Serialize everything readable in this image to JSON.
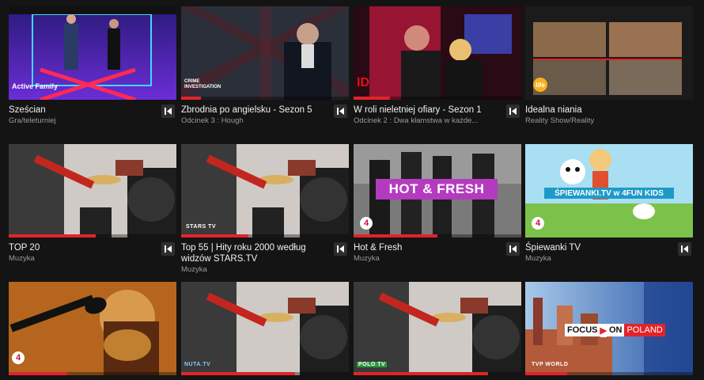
{
  "rows": [
    [
      {
        "title": "Sześcian",
        "subtitle": "Gra/teleturniej",
        "progress": 0,
        "badge": "Active Family"
      },
      {
        "title": "Zbrodnia po angielsku - Sezon 5",
        "subtitle": "Odcinek 3 : Hough",
        "progress": 0.12,
        "badge": "CRIME INVESTIGATION"
      },
      {
        "title": "W roli nieletniej ofiary - Sezon 1",
        "subtitle": "Odcinek 2 : Dwa kłamstwa w każde...",
        "progress": 0.22,
        "badge": "ID"
      },
      {
        "title": "Idealna niania",
        "subtitle": "Reality Show/Reality",
        "progress": 0,
        "badge": "life"
      }
    ],
    [
      {
        "title": "TOP 20",
        "subtitle": "Muzyka",
        "progress": 0.52,
        "badge": ""
      },
      {
        "title": "Top 55 | Hity roku 2000 według widzów STARS.TV",
        "subtitle": "Muzyka",
        "progress": 0.4,
        "badge": "STARS TV"
      },
      {
        "title": "Hot & Fresh",
        "subtitle": "Muzyka",
        "progress": 0.5,
        "badge": "4",
        "banner": "HOT & FRESH"
      },
      {
        "title": "Śpiewanki TV",
        "subtitle": "Muzyka",
        "progress": 0,
        "badge": "4",
        "banner": "ŚPIEWANKI.TV w 4FUN KIDS"
      }
    ],
    [
      {
        "title": "",
        "subtitle": "",
        "progress": 0.35,
        "badge": "4"
      },
      {
        "title": "",
        "subtitle": "",
        "progress": 0.68,
        "badge": "NUTA.TV"
      },
      {
        "title": "",
        "subtitle": "",
        "progress": 0.8,
        "badge": "POLO TV"
      },
      {
        "title": "",
        "subtitle": "",
        "progress": 0.25,
        "badge": "TVP WORLD",
        "banner_a": "FOCUS",
        "banner_b": "ON",
        "banner_c": "POLAND"
      }
    ]
  ],
  "colors": {
    "accent": "#e3232a",
    "background": "#141414",
    "muted": "#9a9a9a"
  },
  "icons": {
    "restart": "skip-back-icon"
  }
}
